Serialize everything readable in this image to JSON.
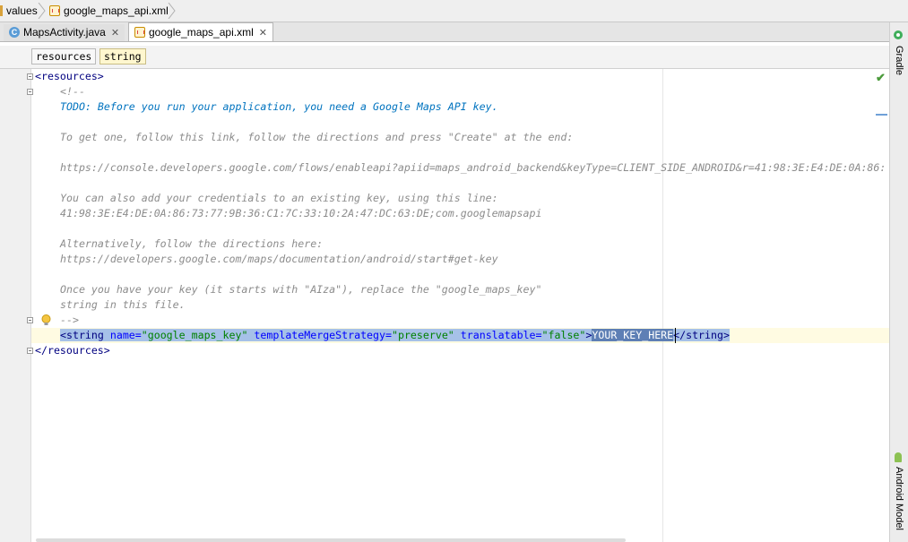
{
  "breadcrumb": {
    "items": [
      "values",
      "google_maps_api.xml"
    ]
  },
  "tabs": [
    {
      "label": "MapsActivity.java",
      "icon": "java-class-icon",
      "active": false
    },
    {
      "label": "google_maps_api.xml",
      "icon": "xml-file-icon",
      "active": true
    }
  ],
  "path_bar": [
    "resources",
    "string"
  ],
  "editor_lines": [
    "<resources>",
    "<!--",
    "TODO: Before you run your application, you need a Google Maps API key.",
    "To get one, follow this link, follow the directions and press \"Create\" at the end:",
    "https://console.developers.google.com/flows/enableapi?apiid=maps_android_backend&keyType=CLIENT_SIDE_ANDROID&r=41:98:3E:E4:DE:0A:86:",
    "You can also add your credentials to an existing key, using this line:",
    "41:98:3E:E4:DE:0A:86:73:77:9B:36:C1:7C:33:10:2A:47:DC:63:DE;com.googlemapsapi",
    "Alternatively, follow the directions here:",
    "https://developers.google.com/maps/documentation/android/start#get-key",
    "Once you have your key (it starts with \"AIza\"), replace the \"google_maps_key\"",
    "string in this file.",
    "-->",
    "</resources>"
  ],
  "string_element": {
    "open_tag": "<string",
    "attr_name": "name=",
    "attr_name_value": "\"google_maps_key\"",
    "attr_merge": "templateMergeStrategy=",
    "attr_merge_value": "\"preserve\"",
    "attr_translatable": "translatable=",
    "attr_translatable_value": "\"false\"",
    "open_close": ">",
    "value": "YOUR_KEY_HERE",
    "close_tag": "</string>"
  },
  "right_tool_strip": [
    "Gradle",
    "Android Model"
  ],
  "colors": {
    "comment": "#8c8c8c",
    "todo": "#0073bf",
    "tag": "#000080",
    "attribute": "#0000ff",
    "string": "#008000",
    "selection": "#a6c1e8"
  }
}
